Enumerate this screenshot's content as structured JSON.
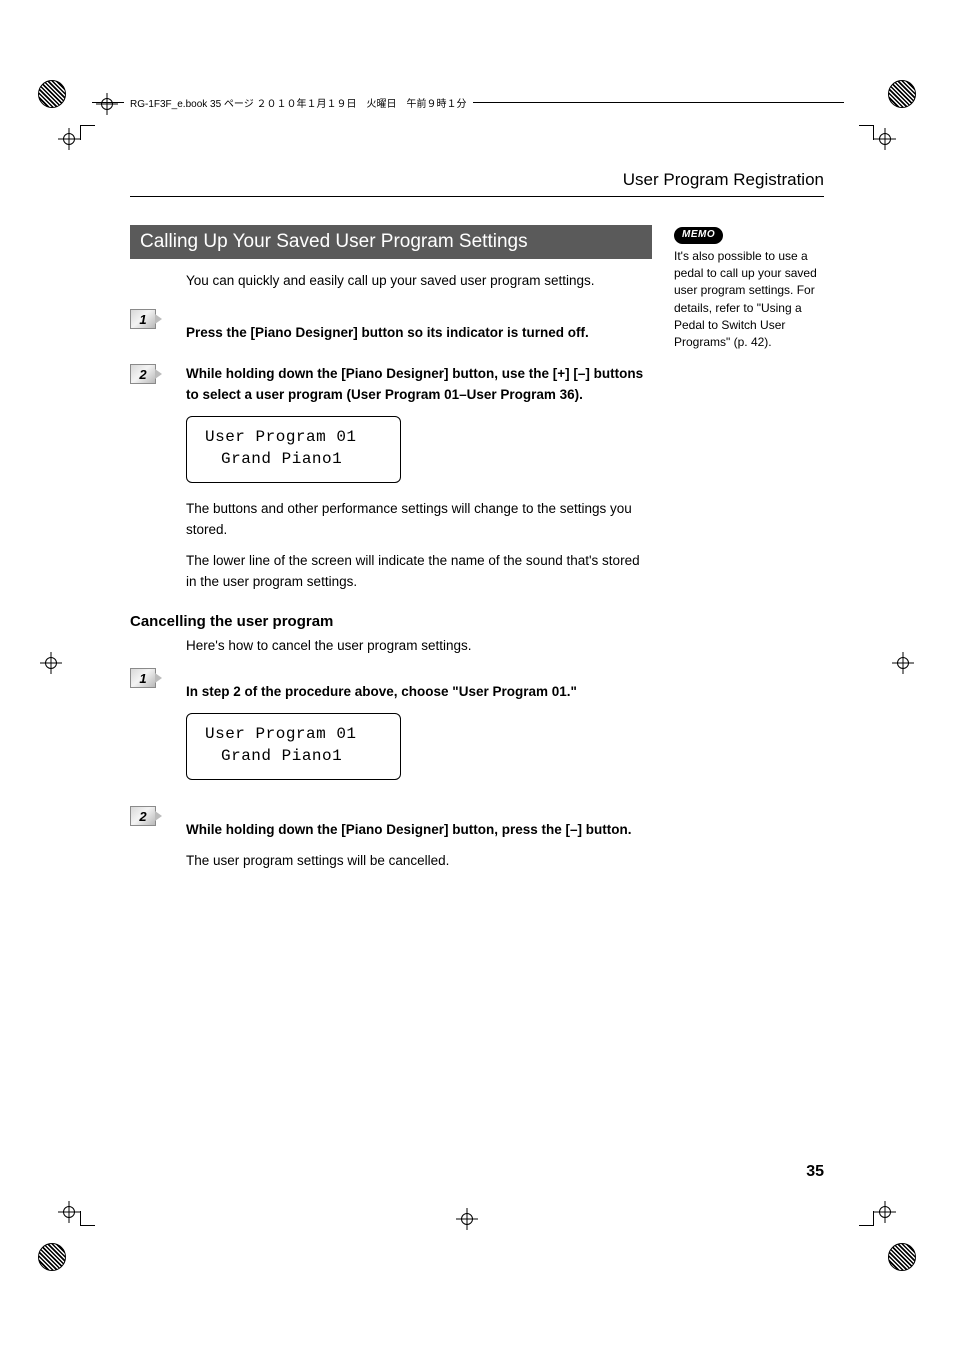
{
  "meta": {
    "file_info": "RG-1F3F_e.book 35 ページ ２０１０年１月１９日　火曜日　午前９時１分"
  },
  "header": {
    "title": "User Program Registration"
  },
  "section": {
    "title": "Calling Up Your Saved User Program Settings",
    "intro": "You can quickly and easily call up your saved user program settings.",
    "step1": {
      "num": "1",
      "text": "Press the [Piano Designer] button so its indicator is turned off."
    },
    "step2": {
      "num": "2",
      "text": "While holding down the [Piano Designer] button, use the [+] [–] buttons to select a user program (User Program 01–User Program 36).",
      "lcd_line1": "User Program 01",
      "lcd_line2": "Grand Piano1",
      "para1": "The buttons and other performance settings will change to the settings you stored.",
      "para2": "The lower line of the screen will indicate the name of the sound that's stored in the user program settings."
    }
  },
  "cancel": {
    "heading": "Cancelling the user program",
    "intro": "Here's how to cancel the user program settings.",
    "step1": {
      "num": "1",
      "text": "In step 2 of the procedure above, choose \"User Program 01.\"",
      "lcd_line1": "User Program 01",
      "lcd_line2": "Grand Piano1"
    },
    "step2": {
      "num": "2",
      "text": "While holding down the [Piano Designer] button, press the [–] button.",
      "para": "The user program settings will be cancelled."
    }
  },
  "memo": {
    "label": "MEMO",
    "text": "It's also possible to use a pedal to call up your saved user program settings. For details, refer to  \"Using a Pedal to Switch User Programs\" (p. 42)."
  },
  "page_number": "35"
}
